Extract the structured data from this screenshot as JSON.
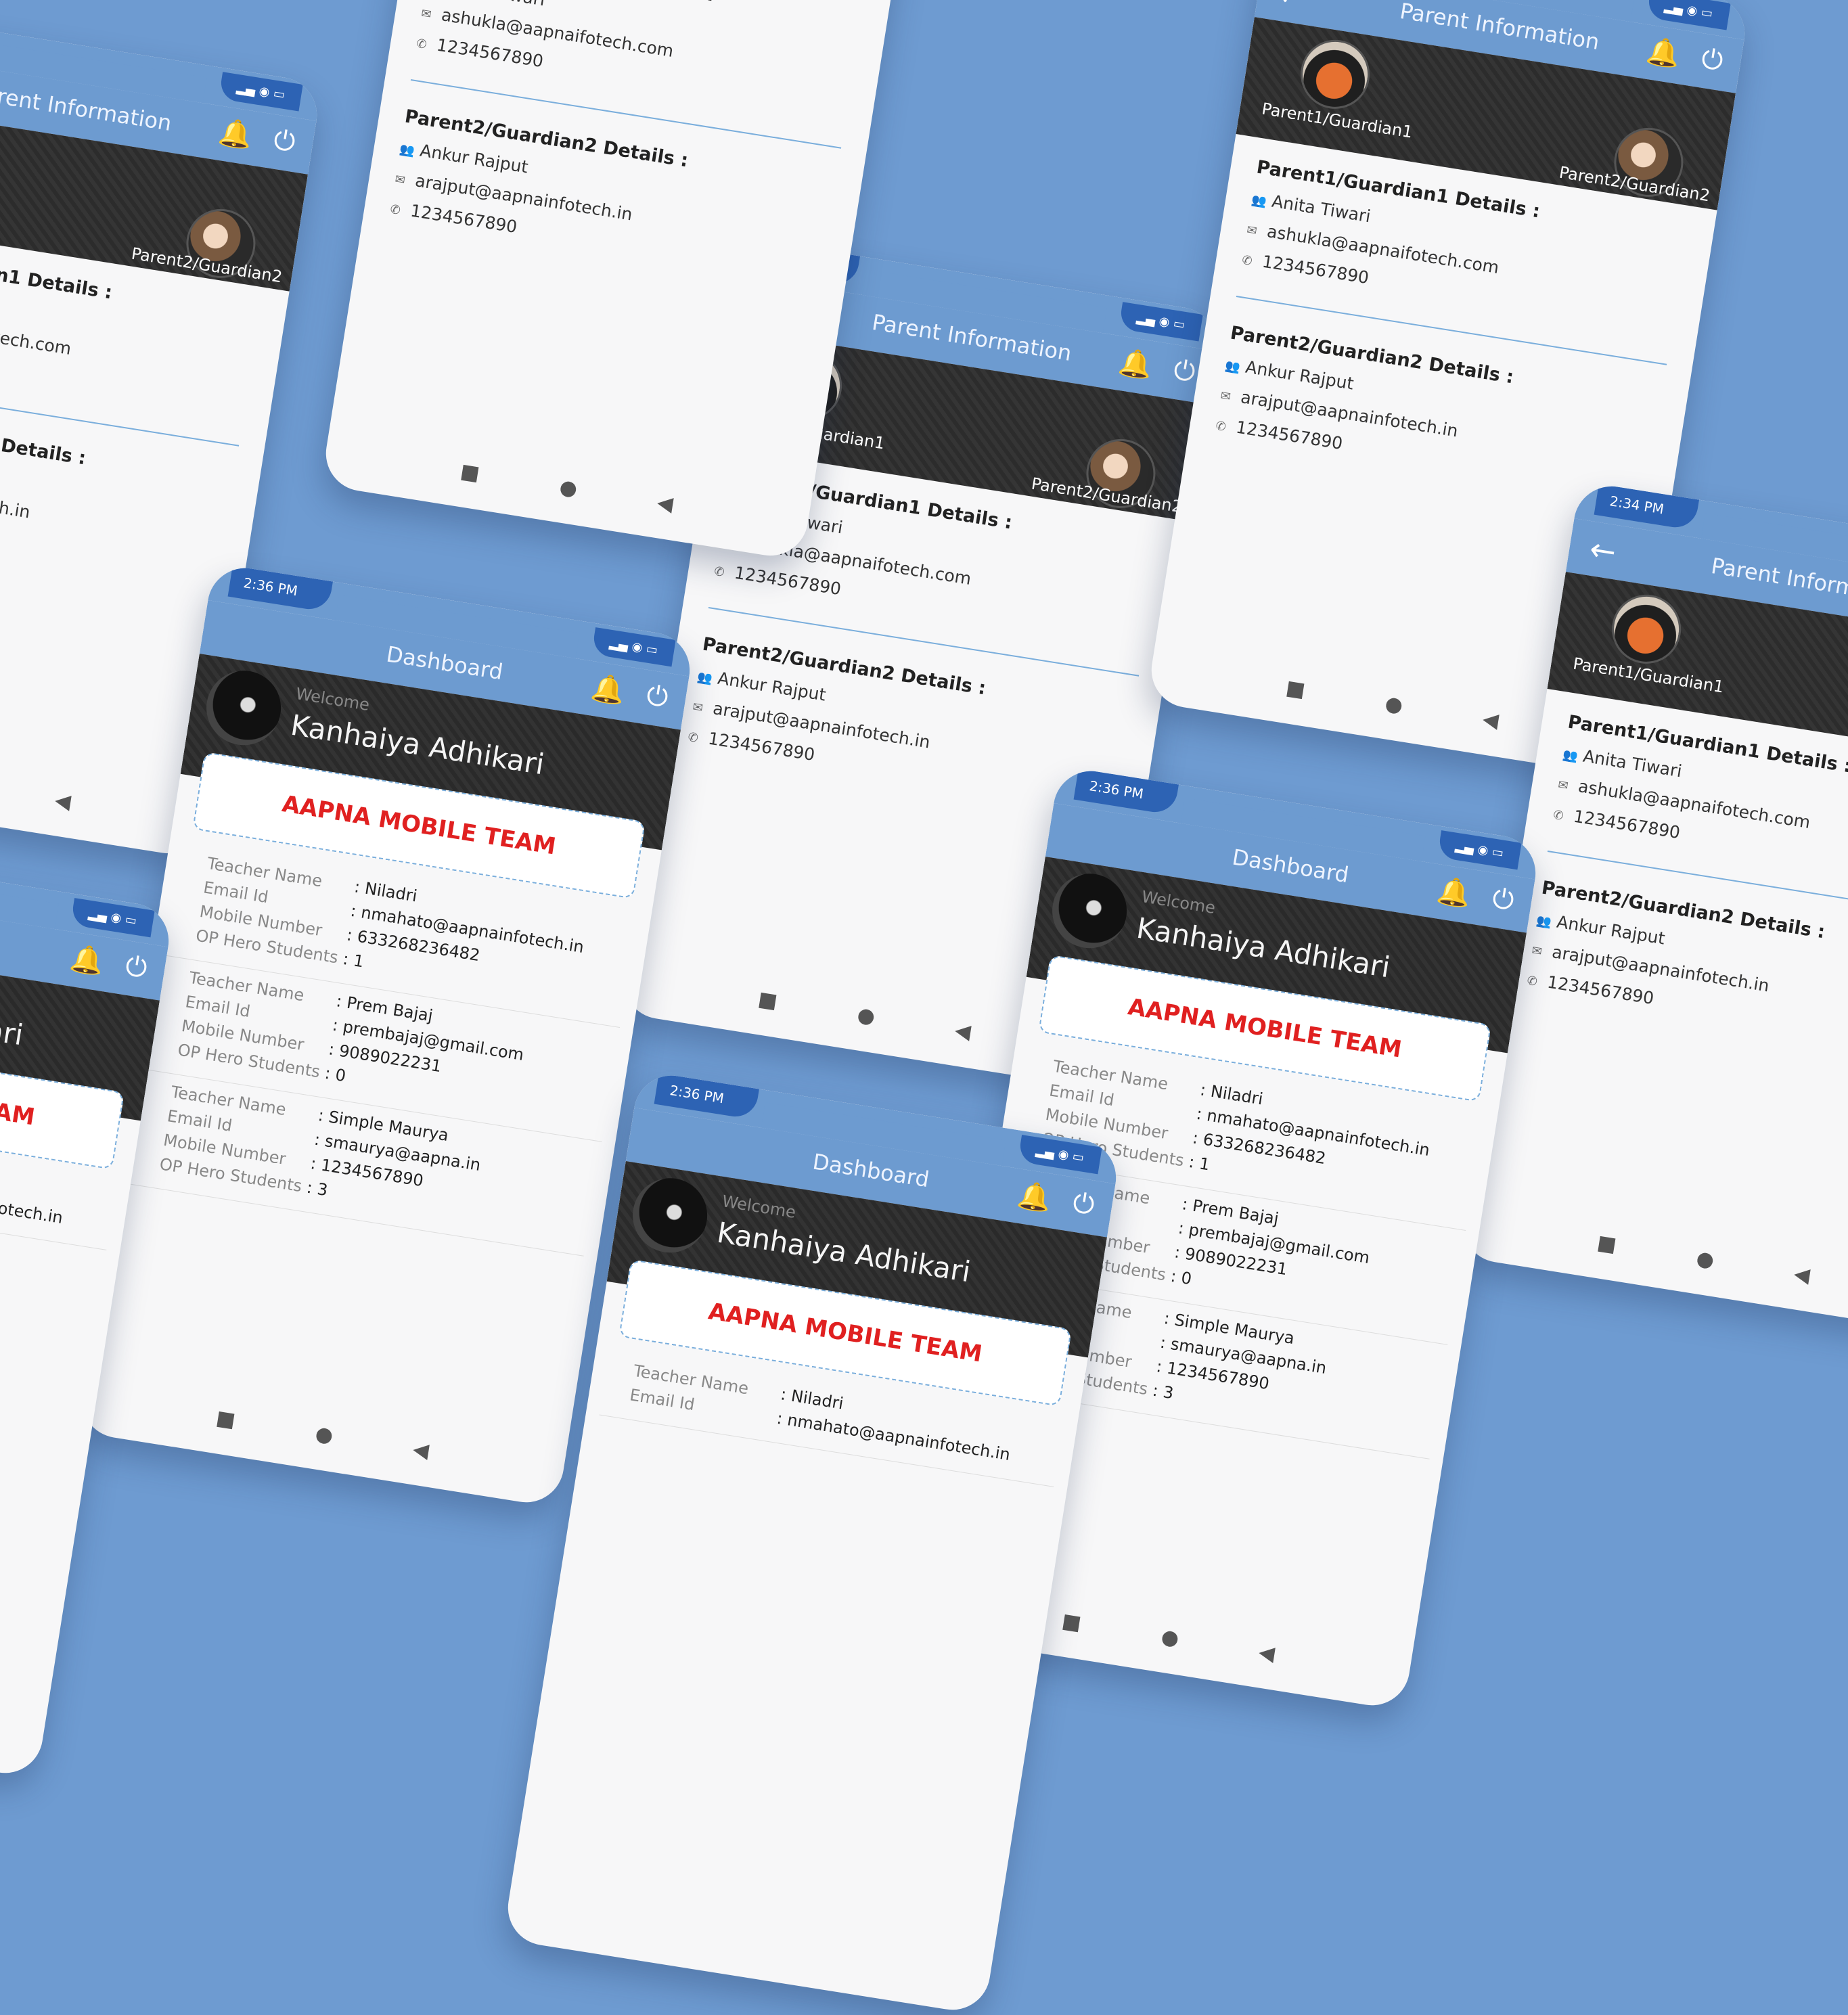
{
  "parent_screen": {
    "status_time": "2:34 PM",
    "title": "Parent Information",
    "guardian1_label": "Parent1/Guardian1",
    "guardian2_label": "Parent2/Guardian2",
    "p1_heading": "Parent1/Guardian1 Details :",
    "p1_name": "Anita Tiwari",
    "p1_email": "ashukla@aapnaifotech.com",
    "p1_phone": "1234567890",
    "p2_heading": "Parent2/Guardian2 Details :",
    "p2_name": "Ankur Rajput",
    "p2_email": "arajput@aapnainfotech.in",
    "p2_phone": "1234567890"
  },
  "dashboard_screen": {
    "status_time": "2:36 PM",
    "title": "Dashboard",
    "welcome": "Welcome",
    "user_name": "Kanhaiya Adhikari",
    "team_title": "AAPNA MOBILE TEAM",
    "labels": {
      "teacher_name": "Teacher Name",
      "email_id": "Email Id",
      "mobile_number": "Mobile Number",
      "op_hero_students": "OP Hero Students"
    },
    "teachers": [
      {
        "name": ": Niladri",
        "email": ": nmahato@aapnainfotech.in",
        "mobile": ": 633268236482",
        "students": ": 1"
      },
      {
        "name": ": Prem Bajaj",
        "email": ": prembajaj@gmail.com",
        "mobile": ": 9089022231",
        "students": ": 0"
      },
      {
        "name": ": Simple Maurya",
        "email": ": smaurya@aapna.in",
        "mobile": ": 1234567890",
        "students": ": 3"
      }
    ]
  },
  "icons": {
    "back": "arrow-left-icon",
    "bell": "bell-icon",
    "power": "power-icon",
    "person": "person-icon",
    "mail": "mail-icon",
    "phone": "phone-icon",
    "nav_square": "recent-apps-icon",
    "nav_circle": "home-icon",
    "nav_triangle": "back-triangle-icon"
  },
  "colors": {
    "background": "#6e9bd1",
    "appbar": "#6d9bd0",
    "status_pill": "#2d63b4",
    "team_text": "#e02020",
    "divider": "#7aaedc"
  }
}
